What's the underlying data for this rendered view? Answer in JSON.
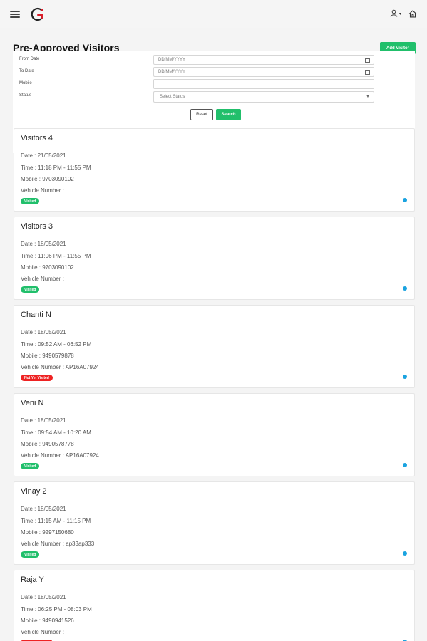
{
  "header": {
    "menu_icon": "hamburger-menu-icon",
    "logo": "app-logo",
    "user_icon": "user-icon",
    "dropdown_icon": "caret-down-icon",
    "home_icon": "home-icon"
  },
  "page": {
    "title": "Pre-Approved Visitors",
    "add_button": "Add Visitor"
  },
  "filters": {
    "from_date_label": "From Date",
    "from_date_placeholder": "DD/MM/YYYY",
    "to_date_label": "To Date",
    "to_date_placeholder": "DD/MM/YYYY",
    "mobile_label": "Mobile",
    "mobile_value": "",
    "status_label": "Status",
    "status_selected": "Select Status",
    "reset_button": "Reset",
    "search_button": "Search"
  },
  "colors": {
    "accent_green": "#21bf6b",
    "not_visited_red": "#ee2222",
    "dot_blue": "#1aa3e0"
  },
  "visitors": [
    {
      "name": "Visitors 4",
      "date": "Date : 21/05/2021",
      "time": "Time : 11:18 PM - 11:55 PM",
      "mobile": "Mobile : 9703090102",
      "vehicle": "Vehicle Number :",
      "status": "Visited"
    },
    {
      "name": "Visitors 3",
      "date": "Date : 18/05/2021",
      "time": "Time : 11:06 PM - 11:55 PM",
      "mobile": "Mobile : 9703090102",
      "vehicle": "Vehicle Number :",
      "status": "Visited"
    },
    {
      "name": "Chanti N",
      "date": "Date : 18/05/2021",
      "time": "Time : 09:52 AM - 06:52 PM",
      "mobile": "Mobile : 9490579878",
      "vehicle": "Vehicle Number : AP16A07924",
      "status": "Not Yet Visited"
    },
    {
      "name": "Veni N",
      "date": "Date : 18/05/2021",
      "time": "Time : 09:54 AM - 10:20 AM",
      "mobile": "Mobile : 9490578778",
      "vehicle": "Vehicle Number : AP16A07924",
      "status": "Visited"
    },
    {
      "name": "Vinay 2",
      "date": "Date : 18/05/2021",
      "time": "Time : 11:15 AM - 11:15 PM",
      "mobile": "Mobile : 9297150680",
      "vehicle": "Vehicle Number : ap33ap333",
      "status": "Visited"
    },
    {
      "name": "Raja Y",
      "date": "Date : 18/05/2021",
      "time": "Time : 06:25 PM - 08:03 PM",
      "mobile": "Mobile : 9490941526",
      "vehicle": "Vehicle Number :",
      "status": "Not Yet Visited"
    }
  ]
}
